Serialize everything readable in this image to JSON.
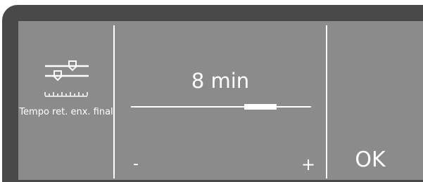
{
  "parameter": {
    "icon": "fader-adjust-icon",
    "label": "Tempo ret. enx. final"
  },
  "setting": {
    "value": "8 min",
    "level_fraction": 0.72
  },
  "controls": {
    "minus_label": "-",
    "plus_label": "+",
    "ok_label": "OK"
  },
  "colors": {
    "screen_bg": "#8b8b8b",
    "frame": "#494949",
    "foreground": "#ffffff"
  }
}
